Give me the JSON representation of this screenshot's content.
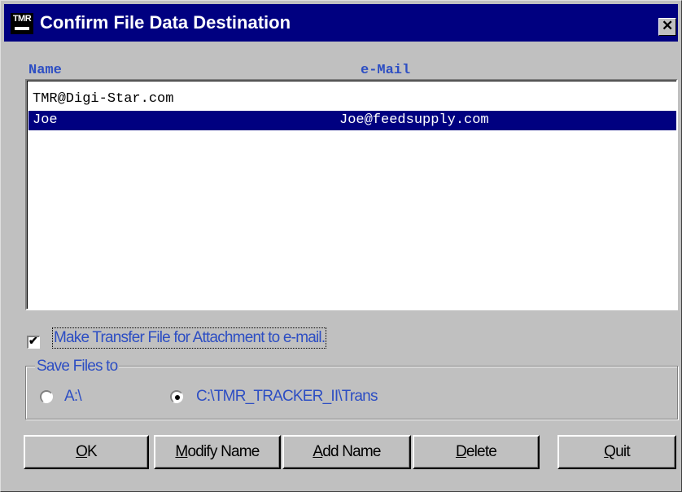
{
  "window": {
    "title": "Confirm File Data Destination",
    "icon_text": "TMR"
  },
  "list": {
    "columns": [
      "Name",
      "e-Mail"
    ],
    "rows": [
      {
        "name": "TMR@Digi-Star.com",
        "email": "",
        "selected": false
      },
      {
        "name": "Joe",
        "email": "Joe@feedsupply.com",
        "selected": true
      }
    ]
  },
  "attachment_checkbox": {
    "label": "Make Transfer File for Attachment to e-mail.",
    "checked": true
  },
  "save_files": {
    "group_label": "Save Files to",
    "options": [
      {
        "label": "A:\\",
        "selected": false
      },
      {
        "label": "C:\\TMR_TRACKER_II\\Trans",
        "selected": true
      }
    ]
  },
  "buttons": {
    "ok": {
      "accel": "O",
      "rest": "K"
    },
    "modify": {
      "accel": "M",
      "rest": "odify Name"
    },
    "add": {
      "accel": "A",
      "rest": "dd Name"
    },
    "delete": {
      "accel": "D",
      "rest": "elete"
    },
    "quit": {
      "accel": "Q",
      "rest": "uit"
    }
  },
  "colors": {
    "titlebar": "#000080",
    "label_blue": "#2d4ec3",
    "selection": "#000080"
  }
}
